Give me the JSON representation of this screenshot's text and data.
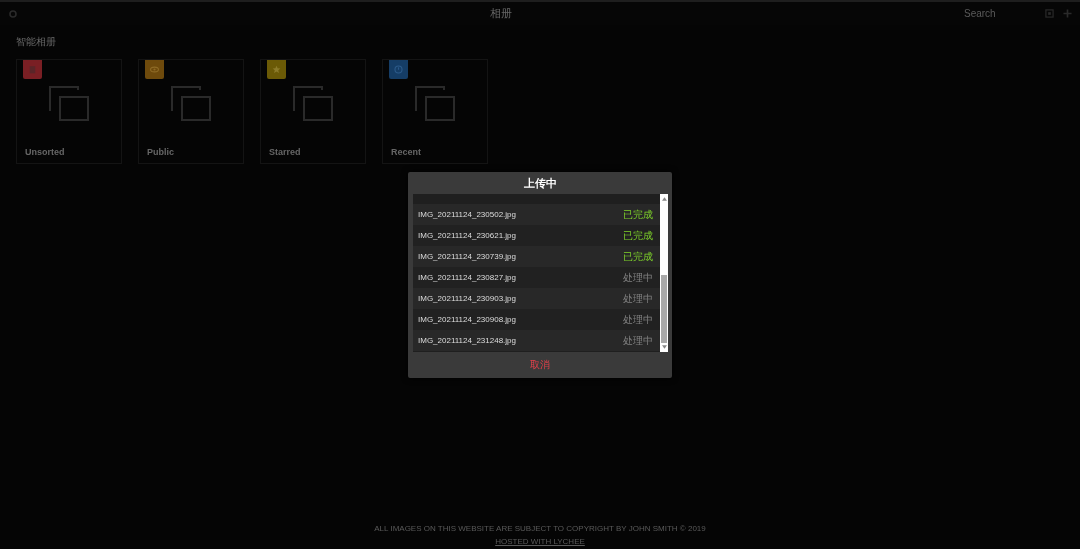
{
  "header": {
    "title": "相册",
    "search": {
      "placeholder": "Search"
    }
  },
  "section": {
    "title": "智能相册"
  },
  "albums": [
    {
      "title": "Unsorted",
      "color": "#7a1f24"
    },
    {
      "title": "Public",
      "color": "#6e4a0c"
    },
    {
      "title": "Starred",
      "color": "#6b5a06"
    },
    {
      "title": "Recent",
      "color": "#153d66"
    }
  ],
  "dialog": {
    "title": "上传中",
    "files": [
      {
        "name": "IMG_20211124_230502.jpg",
        "status": "已完成",
        "kind": "done"
      },
      {
        "name": "IMG_20211124_230621.jpg",
        "status": "已完成",
        "kind": "done"
      },
      {
        "name": "IMG_20211124_230739.jpg",
        "status": "已完成",
        "kind": "done"
      },
      {
        "name": "IMG_20211124_230827.jpg",
        "status": "处理中",
        "kind": "processing"
      },
      {
        "name": "IMG_20211124_230903.jpg",
        "status": "处理中",
        "kind": "processing"
      },
      {
        "name": "IMG_20211124_230908.jpg",
        "status": "处理中",
        "kind": "processing"
      },
      {
        "name": "IMG_20211124_231248.jpg",
        "status": "处理中",
        "kind": "processing"
      }
    ],
    "cancel": "取消"
  },
  "footer": {
    "copyright": "ALL IMAGES ON THIS WEBSITE ARE SUBJECT TO COPYRIGHT BY JOHN SMITH © 2019",
    "hosted": "HOSTED WITH LYCHEE"
  }
}
